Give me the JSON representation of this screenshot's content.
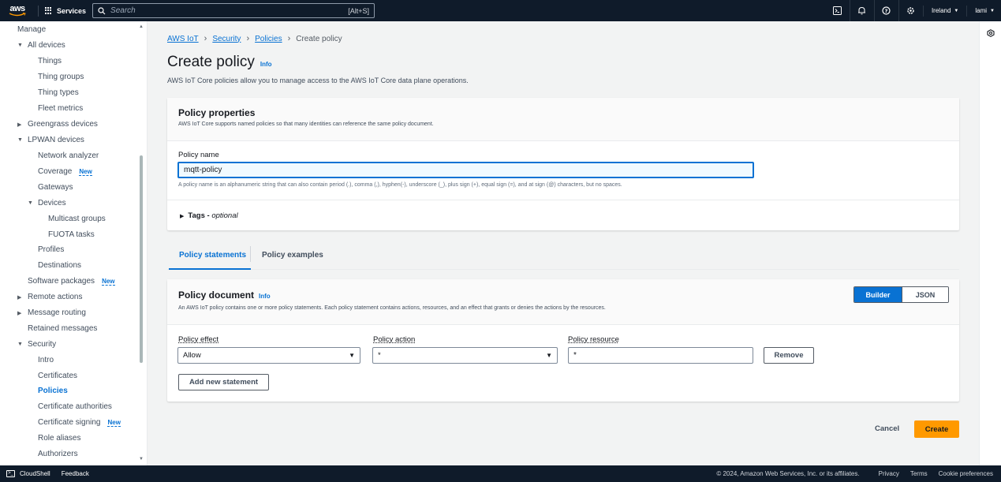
{
  "topnav": {
    "logo": "aws",
    "services": "Services",
    "search_placeholder": "Search",
    "search_shortcut": "[Alt+S]",
    "region": "Ireland",
    "user": "lami"
  },
  "sidebar": {
    "items": [
      {
        "label": "Manage",
        "level": 0,
        "arrow": ""
      },
      {
        "label": "All devices",
        "level": 0,
        "arrow": "▼"
      },
      {
        "label": "Things",
        "level": 1
      },
      {
        "label": "Thing groups",
        "level": 1
      },
      {
        "label": "Thing types",
        "level": 1
      },
      {
        "label": "Fleet metrics",
        "level": 1
      },
      {
        "label": "Greengrass devices",
        "level": 0,
        "arrow": "▶"
      },
      {
        "label": "LPWAN devices",
        "level": 0,
        "arrow": "▼"
      },
      {
        "label": "Network analyzer",
        "level": 1
      },
      {
        "label": "Coverage",
        "level": 1,
        "badge": "New"
      },
      {
        "label": "Gateways",
        "level": 1
      },
      {
        "label": "Devices",
        "level": 1,
        "arrow": "▼"
      },
      {
        "label": "Multicast groups",
        "level": 2
      },
      {
        "label": "FUOTA tasks",
        "level": 2
      },
      {
        "label": "Profiles",
        "level": 1
      },
      {
        "label": "Destinations",
        "level": 1
      },
      {
        "label": "Software packages",
        "level": 0,
        "badge": "New"
      },
      {
        "label": "Remote actions",
        "level": 0,
        "arrow": "▶"
      },
      {
        "label": "Message routing",
        "level": 0,
        "arrow": "▶"
      },
      {
        "label": "Retained messages",
        "level": 0
      },
      {
        "label": "Security",
        "level": 0,
        "arrow": "▼"
      },
      {
        "label": "Intro",
        "level": 1
      },
      {
        "label": "Certificates",
        "level": 1
      },
      {
        "label": "Policies",
        "level": 1,
        "active": true
      },
      {
        "label": "Certificate authorities",
        "level": 1
      },
      {
        "label": "Certificate signing",
        "level": 1,
        "badge": "New"
      },
      {
        "label": "Role aliases",
        "level": 1
      },
      {
        "label": "Authorizers",
        "level": 1
      }
    ]
  },
  "breadcrumb": {
    "items": [
      "AWS IoT",
      "Security",
      "Policies"
    ],
    "current": "Create policy"
  },
  "page": {
    "title": "Create policy",
    "info": "Info",
    "description": "AWS IoT Core policies allow you to manage access to the AWS IoT Core data plane operations."
  },
  "properties": {
    "heading": "Policy properties",
    "subheading": "AWS IoT Core supports named policies so that many identities can reference the same policy document.",
    "name_label": "Policy name",
    "name_value": "mqtt-policy",
    "name_hint": "A policy name is an alphanumeric string that can also contain period (.), comma (,), hyphen(-), underscore (_), plus sign (+), equal sign (=), and at sign (@) characters, but no spaces.",
    "tags_label": "Tags - ",
    "tags_optional": "optional"
  },
  "tabs": {
    "statements": "Policy statements",
    "examples": "Policy examples"
  },
  "document": {
    "heading": "Policy document",
    "info": "Info",
    "subheading": "An AWS IoT policy contains one or more policy statements. Each policy statement contains actions, resources, and an effect that grants or denies the actions by the resources.",
    "builder": "Builder",
    "json": "JSON",
    "effect_label": "Policy effect",
    "effect_value": "Allow",
    "action_label": "Policy action",
    "action_value": "*",
    "resource_label": "Policy resource",
    "resource_value": "*",
    "remove": "Remove",
    "add_statement": "Add new statement"
  },
  "actions": {
    "cancel": "Cancel",
    "create": "Create"
  },
  "footer": {
    "cloudshell": "CloudShell",
    "feedback": "Feedback",
    "copyright": "© 2024, Amazon Web Services, Inc. or its affiliates.",
    "privacy": "Privacy",
    "terms": "Terms",
    "cookies": "Cookie preferences"
  },
  "colors": {
    "nav_bg": "#0f1b2a",
    "primary": "#0972d3",
    "create_button": "#ff9900"
  }
}
